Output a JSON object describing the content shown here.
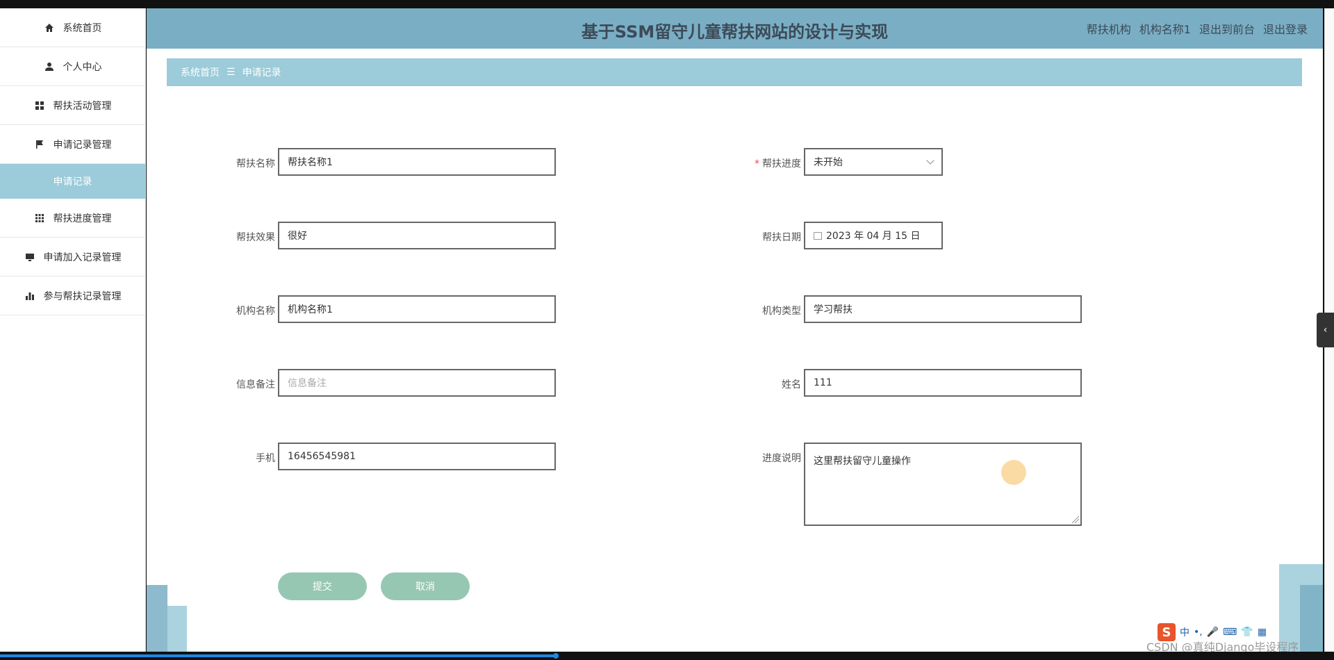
{
  "header": {
    "title": "基于SSM留守儿童帮扶网站的设计与实现",
    "role": "帮扶机构",
    "username": "机构名称1",
    "exit_front": "退出到前台",
    "logout": "退出登录"
  },
  "sidebar": {
    "items": [
      {
        "label": "系统首页",
        "icon": "home-icon"
      },
      {
        "label": "个人中心",
        "icon": "user-icon"
      },
      {
        "label": "帮扶活动管理",
        "icon": "grid-icon"
      },
      {
        "label": "申请记录管理",
        "icon": "flag-icon"
      },
      {
        "label": "帮扶进度管理",
        "icon": "apps-icon"
      },
      {
        "label": "申请加入记录管理",
        "icon": "monitor-icon"
      },
      {
        "label": "参与帮扶记录管理",
        "icon": "bar-chart-icon"
      }
    ],
    "active_sub": "申请记录"
  },
  "breadcrumb": {
    "home": "系统首页",
    "sep": "☰",
    "current": "申请记录"
  },
  "form": {
    "help_name": {
      "label": "帮扶名称",
      "value": "帮扶名称1"
    },
    "progress": {
      "label": "帮扶进度",
      "required": "*",
      "value": "未开始"
    },
    "effect": {
      "label": "帮扶效果",
      "value": "很好"
    },
    "date": {
      "label": "帮扶日期",
      "value": "2023 年 04 月 15 日"
    },
    "org_name": {
      "label": "机构名称",
      "value": "机构名称1"
    },
    "org_type": {
      "label": "机构类型",
      "value": "学习帮扶"
    },
    "remark": {
      "label": "信息备注",
      "placeholder": "信息备注"
    },
    "name": {
      "label": "姓名",
      "value": "111"
    },
    "phone": {
      "label": "手机",
      "value": "16456545981"
    },
    "progress_desc": {
      "label": "进度说明",
      "value": "这里帮扶留守儿童操作"
    }
  },
  "buttons": {
    "submit": "提交",
    "cancel": "取消"
  },
  "ime": {
    "logo": "S",
    "mode": "中"
  },
  "watermark": "CSDN @真纯Django毕设程序",
  "colors": {
    "header": "#7aaec4",
    "accent": "#9ccbd9",
    "button": "#96c7b3"
  }
}
